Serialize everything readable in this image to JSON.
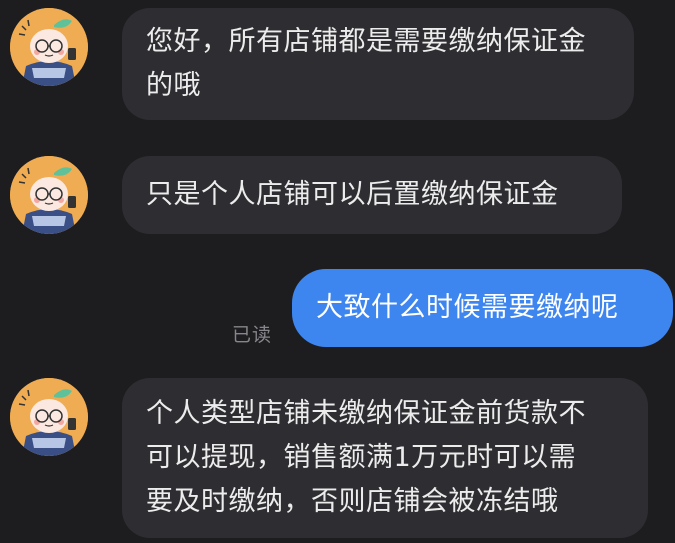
{
  "messages": [
    {
      "sender": "merchant",
      "text": "您好，所有店铺都是需要缴纳保证金\n的哦"
    },
    {
      "sender": "merchant",
      "text": "只是个人店铺可以后置缴纳保证金"
    },
    {
      "sender": "me",
      "text": "大致什么时候需要缴纳呢",
      "status": "已读"
    },
    {
      "sender": "merchant",
      "text": "个人类型店铺未缴纳保证金前货款不\n可以提现，销售额满1万元时可以需\n要及时缴纳，否则店铺会被冻结哦"
    }
  ],
  "colors": {
    "background": "#1d1d20",
    "incoming_bubble": "#2e2e32",
    "outgoing_bubble": "#3e86ef",
    "avatar_bg": "#efac52"
  }
}
